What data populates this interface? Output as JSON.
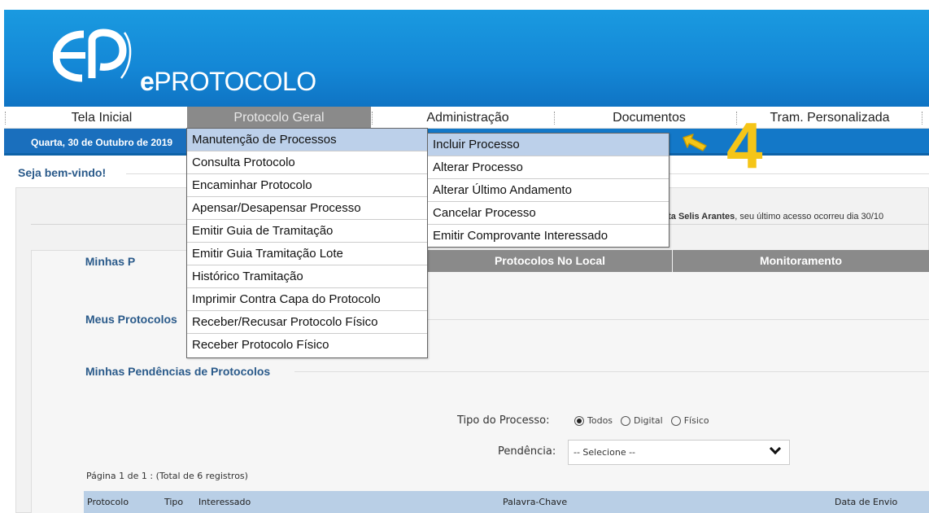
{
  "brand": {
    "logo_e": "e",
    "logo_rest": "PROTOCOLO"
  },
  "nav": {
    "items": [
      "Tela Inicial",
      "Protocolo Geral",
      "Administração",
      "Documentos",
      "Tram. Personalizada"
    ],
    "active": "Protocolo Geral"
  },
  "datebar": {
    "date": "Quarta, 30 de Outubro de 2019"
  },
  "welcome": "Seja bem-vindo!",
  "user_info": {
    "name": "lita Selis Arantes",
    "suffix": ", seu último acesso ocorreu dia 30/10"
  },
  "tabs": {
    "minhas": "Minhas P",
    "no_local": "Protocolos No Local",
    "monitoramento": "Monitoramento"
  },
  "sections": {
    "meus": "Meus Protocolos",
    "pendencias": "Minhas Pendências de Protocolos"
  },
  "filter": {
    "tipo_label": "Tipo do Processo:",
    "options": [
      "Todos",
      "Digital",
      "Físico"
    ],
    "selected": "Todos",
    "pendencia_label": "Pendência:",
    "pendencia_value": "-- Selecione --"
  },
  "pagination": "Página 1 de 1 : (Total de 6 registros)",
  "table": {
    "headers": [
      "Protocolo",
      "Tipo",
      "Interessado",
      "Palavra-Chave",
      "Data de Envio"
    ]
  },
  "menu_protocolo_geral": [
    "Manutenção de Processos",
    "Consulta Protocolo",
    "Encaminhar Protocolo",
    "Apensar/Desapensar Processo",
    "Emitir Guia de Tramitação",
    "Emitir Guia Tramitação Lote",
    "Histórico Tramitação",
    "Imprimir Contra Capa do Protocolo",
    "Receber/Recusar Protocolo Físico",
    "Receber Protocolo Físico"
  ],
  "submenu_manutencao": [
    "Incluir Processo",
    "Alterar Processo",
    "Alterar Último Andamento",
    "Cancelar Processo",
    "Emitir Comprovante Interessado"
  ],
  "annotation": {
    "step_number": "4",
    "color": "#f5c518"
  },
  "colors": {
    "banner": "#1487d6",
    "nav_active": "#8a8a8a",
    "header_blue": "#2a5a8a",
    "menu_highlight": "#bcd0ea"
  }
}
